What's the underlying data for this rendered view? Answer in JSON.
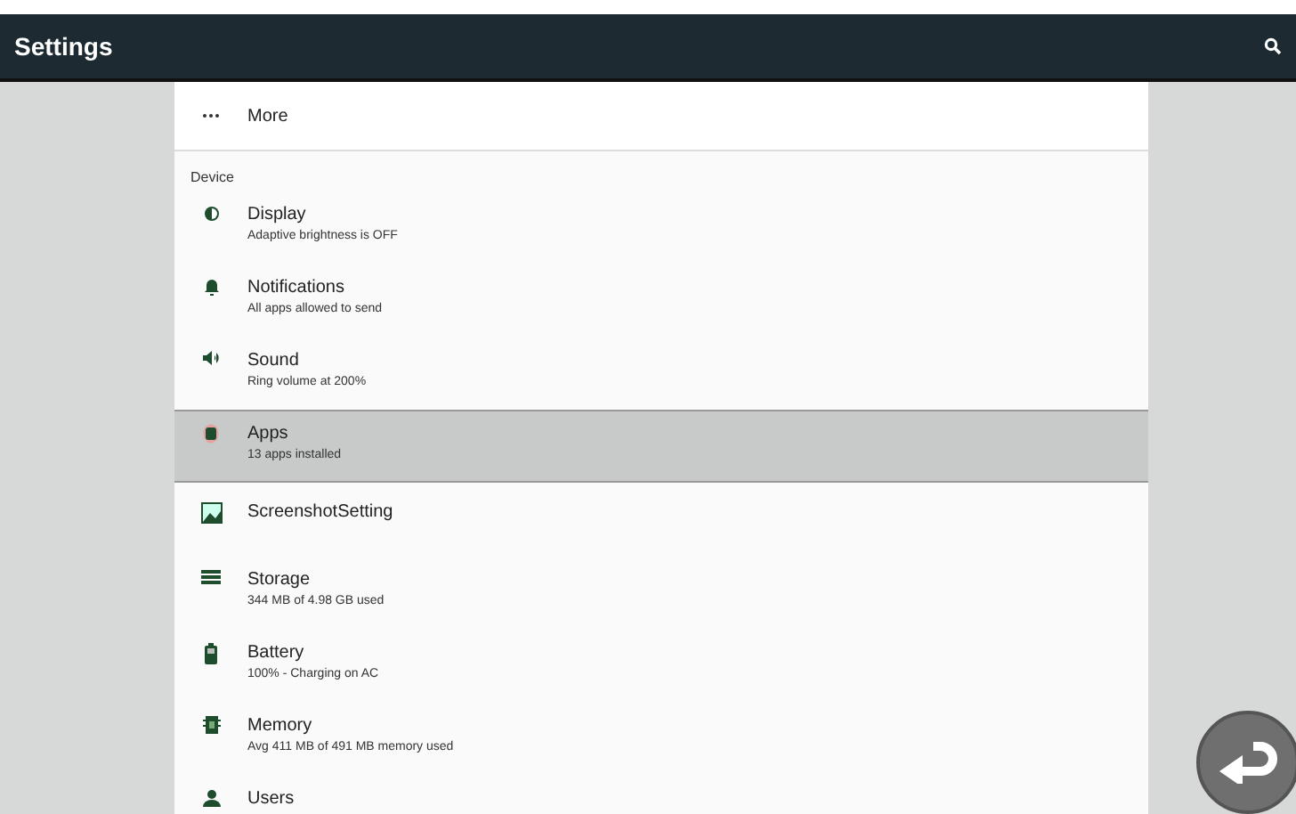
{
  "app_bar": {
    "title": "Settings"
  },
  "more": {
    "label": "More"
  },
  "section": {
    "header": "Device"
  },
  "items": [
    {
      "kind": "display",
      "title": "Display",
      "summary": "Adaptive brightness is OFF",
      "selected": false
    },
    {
      "kind": "bell",
      "title": "Notifications",
      "summary": "All apps allowed to send",
      "selected": false
    },
    {
      "kind": "sound",
      "title": "Sound",
      "summary": "Ring volume at 200%",
      "selected": false
    },
    {
      "kind": "apps",
      "title": "Apps",
      "summary": "13 apps installed",
      "selected": true
    },
    {
      "kind": "image",
      "title": "ScreenshotSetting",
      "selected": false
    },
    {
      "kind": "storage",
      "title": "Storage",
      "summary": "344 MB of 4.98 GB used",
      "selected": false
    },
    {
      "kind": "battery",
      "title": "Battery",
      "summary": "100% - Charging on AC",
      "selected": false
    },
    {
      "kind": "memory",
      "title": "Memory",
      "summary": "Avg 411 MB of 491 MB memory used",
      "selected": false
    },
    {
      "kind": "users",
      "title": "Users",
      "selected": false
    }
  ]
}
